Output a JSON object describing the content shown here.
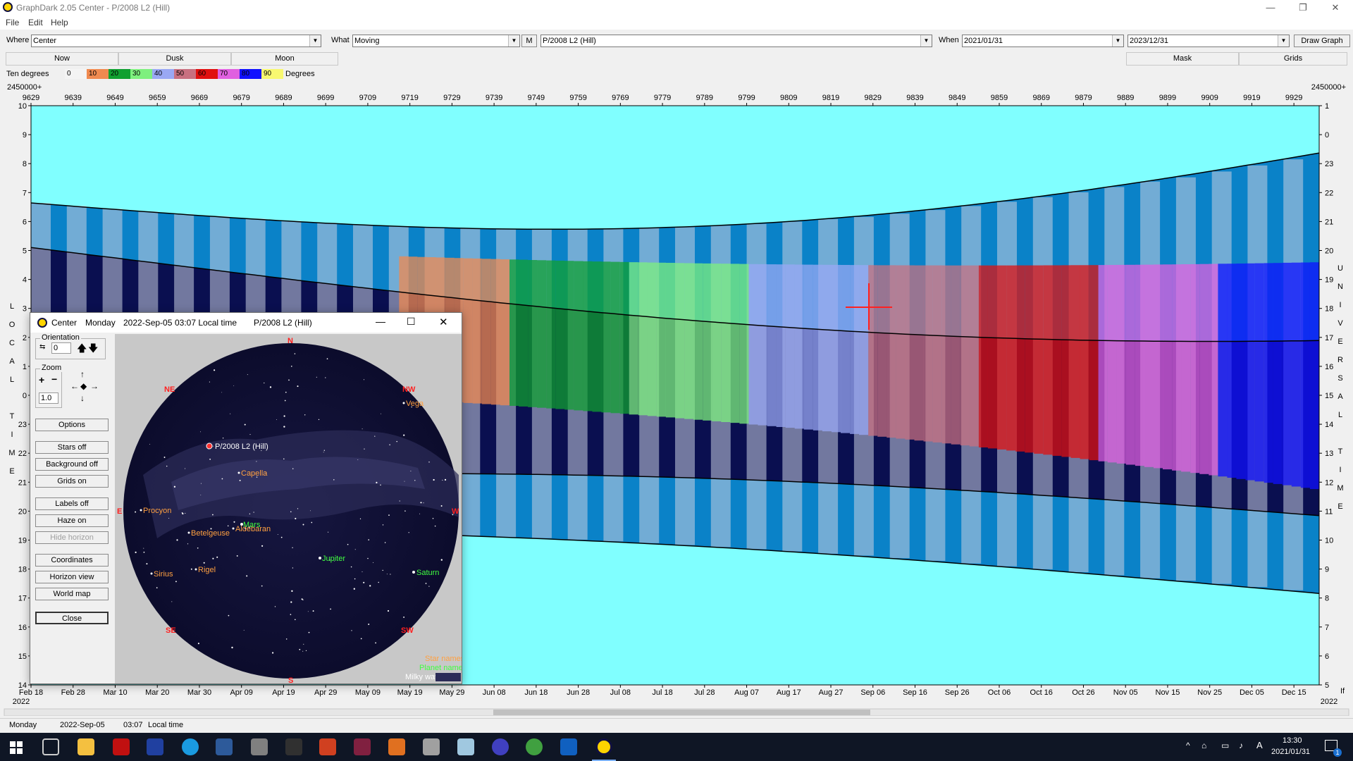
{
  "window": {
    "title": "GraphDark 2.05  Center  -  P/2008 L2 (Hill)",
    "menu": [
      "File",
      "Edit",
      "Help"
    ],
    "controls": [
      "—",
      "❐",
      "✕"
    ]
  },
  "toolbar": {
    "where_label": "Where",
    "where_value": "Center",
    "what_label": "What",
    "what_value": "Moving",
    "m_button": "M",
    "object_value": "P/2008 L2 (Hill)",
    "when_label": "When",
    "start_date": "2021/01/31",
    "end_date": "2023/12/31",
    "draw_button": "Draw Graph"
  },
  "buttons_row": {
    "now": "Now",
    "dusk": "Dusk",
    "moon": "Moon",
    "mask": "Mask",
    "grids": "Grids"
  },
  "legend": {
    "left_label": "Ten degrees",
    "right_label": "Degrees",
    "items": [
      {
        "label": "0",
        "color": "#f4f4f4"
      },
      {
        "label": "10",
        "color": "#f08a50"
      },
      {
        "label": "20",
        "color": "#10a030"
      },
      {
        "label": "30",
        "color": "#7ef07e"
      },
      {
        "label": "40",
        "color": "#9aa8f4"
      },
      {
        "label": "50",
        "color": "#c87080"
      },
      {
        "label": "60",
        "color": "#e01010"
      },
      {
        "label": "70",
        "color": "#e060e0"
      },
      {
        "label": "80",
        "color": "#1010ff"
      },
      {
        "label": "90",
        "color": "#f8f870"
      }
    ]
  },
  "chart": {
    "jd_prefix": "2450000+",
    "jd_ticks": [
      "9629",
      "9639",
      "9649",
      "9659",
      "9669",
      "9679",
      "9689",
      "9699",
      "9709",
      "9719",
      "9729",
      "9739",
      "9749",
      "9759",
      "9769",
      "9779",
      "9789",
      "9799",
      "9809",
      "9819",
      "9829",
      "9839",
      "9849",
      "9859",
      "9869",
      "9879",
      "9889",
      "9899",
      "9909",
      "9919",
      "9929"
    ],
    "date_ticks": [
      "Feb 18",
      "Feb 28",
      "Mar 10",
      "Mar 20",
      "Mar 30",
      "Apr 09",
      "Apr 19",
      "Apr 29",
      "May 09",
      "May 19",
      "May 29",
      "Jun 08",
      "Jun 18",
      "Jun 28",
      "Jul 08",
      "Jul 18",
      "Jul 28",
      "Aug 07",
      "Aug 17",
      "Aug 27",
      "Sep 06",
      "Sep 16",
      "Sep 26",
      "Oct 06",
      "Oct 16",
      "Oct 26",
      "Nov 05",
      "Nov 15",
      "Nov 25",
      "Dec 05",
      "Dec 15"
    ],
    "year_left": "2022",
    "year_right": "2022",
    "left_axis_title": [
      "L",
      "O",
      "C",
      "A",
      "L",
      "",
      "T",
      "I",
      "M",
      "E"
    ],
    "left_axis_ticks": [
      "10",
      "9",
      "8",
      "7",
      "6",
      "5",
      "4",
      "3",
      "2",
      "1",
      "0",
      "23",
      "22",
      "21",
      "20",
      "19",
      "18",
      "17",
      "16",
      "15",
      "14"
    ],
    "right_axis_title": [
      "U",
      "N",
      "I",
      "V",
      "E",
      "R",
      "S",
      "A",
      "L",
      "",
      "T",
      "I",
      "M",
      "E"
    ],
    "right_axis_ticks": [
      "1",
      "0",
      "23",
      "22",
      "21",
      "20",
      "19",
      "18",
      "17",
      "16",
      "15",
      "14",
      "13",
      "12",
      "11",
      "10",
      "9",
      "8",
      "7",
      "6",
      "5"
    ],
    "right_edge_label": "If",
    "colors": {
      "daylight": "#80ffff",
      "night": "#0a0f50",
      "twilight_blue": "#0a82c8",
      "grey": "#c8d0e0",
      "cursor": "#ff2020"
    }
  },
  "popup": {
    "title_location": "Center",
    "title_day": "Monday",
    "title_date": "2022-Sep-05",
    "title_time": "03:07 Local time",
    "title_object": "P/2008 L2 (Hill)",
    "orientation_label": "Orientation",
    "orientation_value": "0",
    "zoom_label": "Zoom",
    "zoom_value": "1.0",
    "buttons": [
      "Options",
      "Stars off",
      "Background off",
      "Grids on",
      "Labels off",
      "Haze on",
      "Hide horizon",
      "Coordinates",
      "Horizon view",
      "World map",
      "Close"
    ],
    "compass": {
      "n": "N",
      "ne": "NE",
      "nw": "NW",
      "e": "E",
      "w": "W",
      "se": "SE",
      "sw": "SW",
      "s": "S"
    },
    "stars": [
      {
        "name": "Vega",
        "color": "#ffa040"
      },
      {
        "name": "Capella",
        "color": "#ffa040"
      },
      {
        "name": "Procyon",
        "color": "#ffa040"
      },
      {
        "name": "Betelgeuse",
        "color": "#ffa040"
      },
      {
        "name": "Aldebaran",
        "color": "#ffa040"
      },
      {
        "name": "Sirius",
        "color": "#ffa040"
      },
      {
        "name": "Rigel",
        "color": "#ffa040"
      }
    ],
    "planets": [
      {
        "name": "Mars",
        "color": "#40ff40"
      },
      {
        "name": "Jupiter",
        "color": "#40ff40"
      },
      {
        "name": "Saturn",
        "color": "#40ff40"
      }
    ],
    "comet_label": "P/2008 L2 (Hill)",
    "legend_star": "Star names",
    "legend_planet": "Planet names",
    "legend_milky": "Milky way"
  },
  "status": {
    "day": "Monday",
    "date": "2022-Sep-05",
    "time": "03:07",
    "time_label": "Local time"
  },
  "taskbar": {
    "clock_time": "13:30",
    "clock_date": "2021/01/31",
    "lang": "A",
    "badge": "1"
  }
}
